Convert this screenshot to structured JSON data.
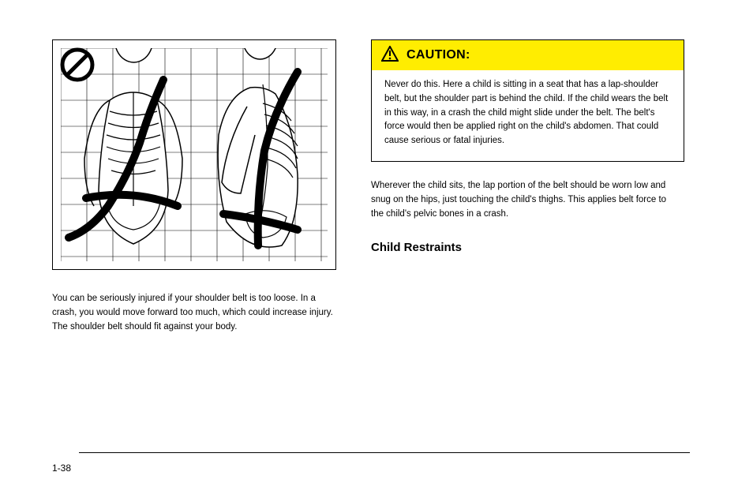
{
  "figure": {
    "alt": "Illustration of incorrect lap-shoulder belt routing across child skeleton, front and side views, with prohibition symbol",
    "prohibit_icon": "prohibition-icon"
  },
  "caption": "You can be seriously injured if your shoulder belt is too loose. In a crash, you would move forward too much, which could increase injury. The shoulder belt should fit against your body.",
  "caution": {
    "label": "CAUTION:",
    "warn_icon": "warning-triangle-icon",
    "body": "Never do this. Here a child is sitting in a seat that has a lap-shoulder belt, but the shoulder part is behind the child. If the child wears the belt in this way, in a crash the child might slide under the belt. The belt's force would then be applied right on the child's abdomen. That could cause serious or fatal injuries."
  },
  "body_text": "Wherever the child sits, the lap portion of the belt should be worn low and snug on the hips, just touching the child's thighs. This applies belt force to the child's pelvic bones in a crash.",
  "subheading": "Child Restraints",
  "page_number": "1-38"
}
